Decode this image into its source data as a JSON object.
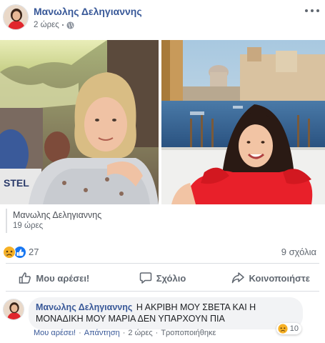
{
  "post": {
    "author": "Μανωλης Δεληγιαννης",
    "time": "2 ώρες",
    "privacy_icon": "globe-icon",
    "more_icon": "more-options-icon"
  },
  "shared": {
    "author": "Μανωλης Δεληγιαννης",
    "time": "19 ώρες"
  },
  "reactions": {
    "icons": [
      "sad-reaction-icon",
      "like-reaction-icon"
    ],
    "count": "27",
    "comments": "9 σχόλια"
  },
  "actions": {
    "like": "Μου αρέσει!",
    "comment": "Σχόλιο",
    "share": "Κοινοποιήστε"
  },
  "comment": {
    "author": "Μανωλης Δεληγιαννης",
    "text": "Η ΑΚΡΙΒΗ ΜΟΥ ΣΒΕΤΑ ΚΑΙ Η ΜΟΝΑΔΙΚΗ ΜΟΥ ΜΑΡΙΑ ΔΕΝ ΥΠΑΡΧΟΥΝ ΠΙΑ",
    "reaction_count": "10",
    "like": "Μου αρέσει!",
    "reply": "Απάντηση",
    "time": "2 ώρες",
    "edited": "Τροποποιήθηκε"
  },
  "colors": {
    "link": "#385898",
    "secondary_text": "#606770",
    "like_blue": "#1877f2",
    "sad_yellow": "#f7b125"
  }
}
